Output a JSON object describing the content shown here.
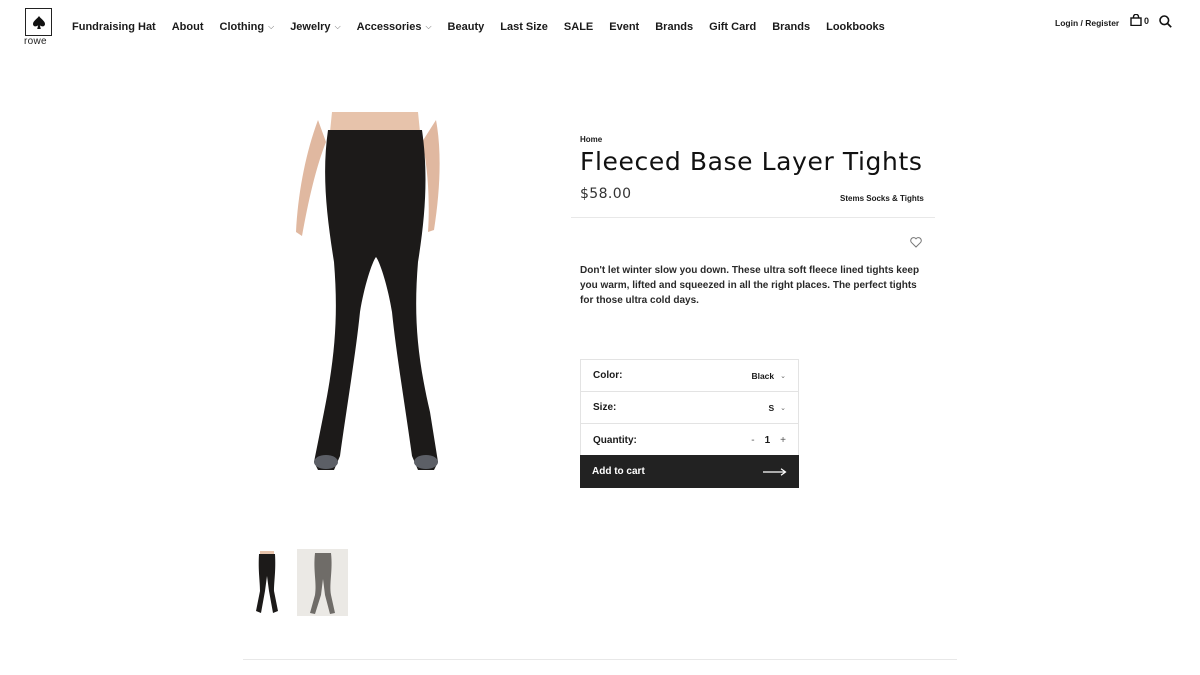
{
  "header": {
    "logo_text": "rowe",
    "nav": [
      {
        "label": "Fundraising Hat",
        "dropdown": false
      },
      {
        "label": "About",
        "dropdown": false
      },
      {
        "label": "Clothing",
        "dropdown": true
      },
      {
        "label": "Jewelry",
        "dropdown": true
      },
      {
        "label": "Accessories",
        "dropdown": true
      },
      {
        "label": "Beauty",
        "dropdown": false
      },
      {
        "label": "Last Size",
        "dropdown": false
      },
      {
        "label": "SALE",
        "dropdown": false
      },
      {
        "label": "Event",
        "dropdown": false
      },
      {
        "label": "Brands",
        "dropdown": false
      },
      {
        "label": "Gift Card",
        "dropdown": false
      },
      {
        "label": "Brands",
        "dropdown": false
      },
      {
        "label": "Lookbooks",
        "dropdown": false
      }
    ],
    "account_label": "Login / Register",
    "cart_count": "0",
    "icons": {
      "logo": "spade-icon",
      "cart": "shopping-bag-icon",
      "search": "search-icon"
    }
  },
  "product": {
    "breadcrumb": "Home",
    "title": "Fleeced Base Layer Tights",
    "price": "$58.00",
    "brand": "Stems Socks & Tights",
    "description": "Don't let winter slow you down. These ultra soft fleece lined tights keep you warm, lifted and squeezed in all the right places. The perfect tights for those ultra cold days.",
    "options": {
      "color_label": "Color:",
      "color_value": "Black",
      "size_label": "Size:",
      "size_value": "S",
      "quantity_label": "Quantity:",
      "quantity_value": "1",
      "minus": "-",
      "plus": "+"
    },
    "add_to_cart": "Add to cart",
    "colors": {
      "button_bg": "#222222",
      "tights": "#1c1a19",
      "thumb2_tights": "#6f6c68"
    }
  }
}
